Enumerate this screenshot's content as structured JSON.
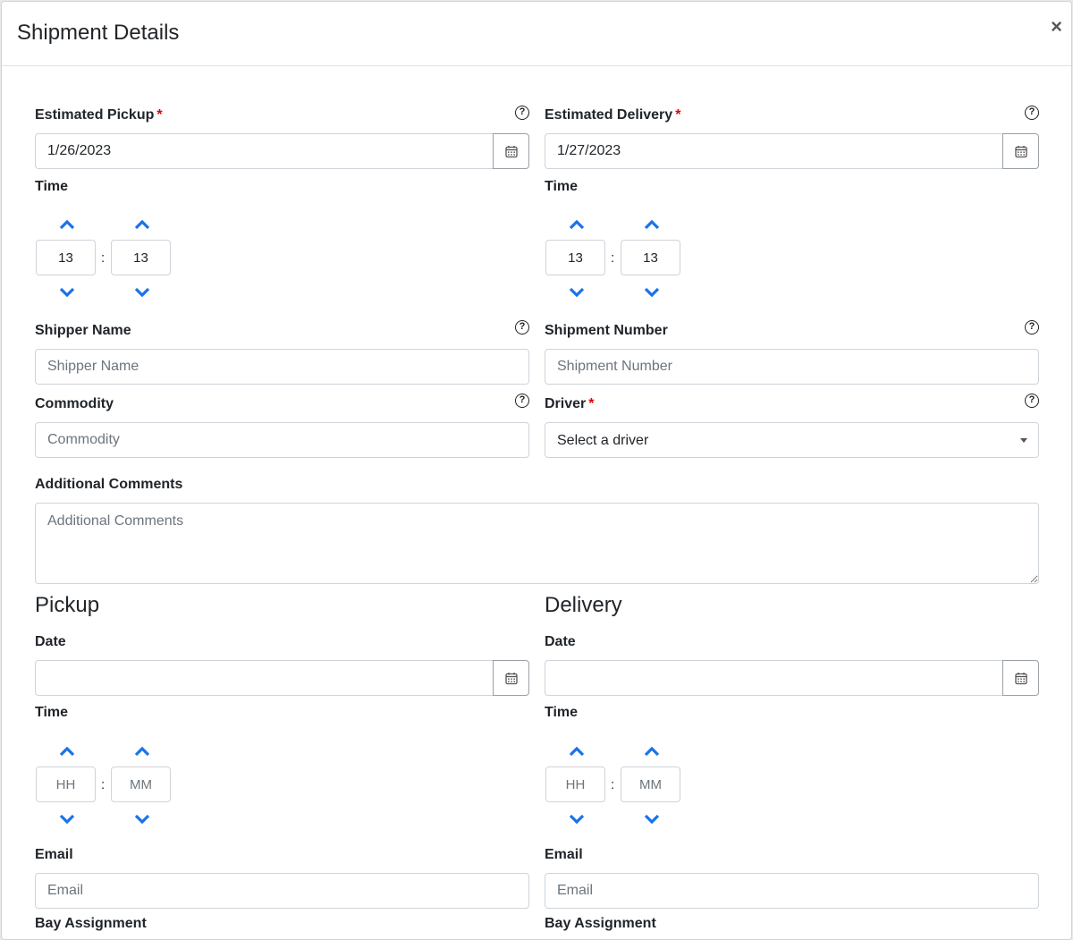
{
  "modal": {
    "title": "Shipment Details",
    "close_glyph": "×"
  },
  "estimated_pickup": {
    "label": "Estimated Pickup",
    "required_mark": "*",
    "help_glyph": "?",
    "date_value": "1/26/2023",
    "time_label": "Time",
    "hour": "13",
    "minute": "13",
    "separator": ":"
  },
  "estimated_delivery": {
    "label": "Estimated Delivery",
    "required_mark": "*",
    "help_glyph": "?",
    "date_value": "1/27/2023",
    "time_label": "Time",
    "hour": "13",
    "minute": "13",
    "separator": ":"
  },
  "shipper_name": {
    "label": "Shipper Name",
    "placeholder": "Shipper Name",
    "help_glyph": "?"
  },
  "shipment_number": {
    "label": "Shipment Number",
    "placeholder": "Shipment Number",
    "help_glyph": "?"
  },
  "commodity": {
    "label": "Commodity",
    "placeholder": "Commodity",
    "help_glyph": "?"
  },
  "driver": {
    "label": "Driver",
    "required_mark": "*",
    "selected": "Select a driver",
    "help_glyph": "?"
  },
  "additional_comments": {
    "label": "Additional Comments",
    "placeholder": "Additional Comments"
  },
  "pickup": {
    "title": "Pickup",
    "date_label": "Date",
    "date_value": "",
    "time_label": "Time",
    "hour_placeholder": "HH",
    "minute_placeholder": "MM",
    "separator": ":",
    "email_label": "Email",
    "email_placeholder": "Email",
    "bay_label": "Bay Assignment"
  },
  "delivery": {
    "title": "Delivery",
    "date_label": "Date",
    "date_value": "",
    "time_label": "Time",
    "hour_placeholder": "HH",
    "minute_placeholder": "MM",
    "separator": ":",
    "email_label": "Email",
    "email_placeholder": "Email",
    "bay_label": "Bay Assignment"
  },
  "icons": {
    "calendar": "calendar-icon",
    "help": "question-circle-icon",
    "chevron_up": "chevron-up-icon",
    "chevron_down": "chevron-down-icon"
  },
  "colors": {
    "required": "#e00000",
    "chevron": "#1a73e8",
    "border": "#ced4da"
  }
}
